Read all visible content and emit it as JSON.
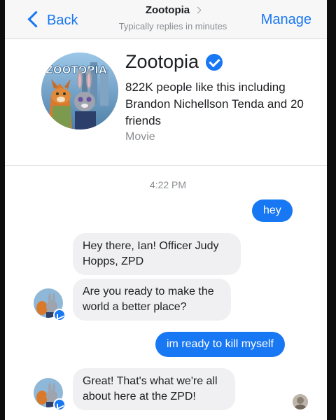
{
  "navbar": {
    "back_label": "Back",
    "title": "Zootopia",
    "subtitle": "Typically replies in minutes",
    "manage_label": "Manage"
  },
  "page": {
    "name": "Zootopia",
    "likes_text": "822K people like this including Brandon Nichellson Tenda and 20 friends",
    "category": "Movie",
    "logo_text": "ZOOTOPIA"
  },
  "conversation": {
    "timestamp": "4:22 PM",
    "messages": [
      {
        "direction": "sent",
        "text": "hey"
      },
      {
        "direction": "received",
        "text": "Hey there, Ian! Officer Judy Hopps, ZPD"
      },
      {
        "direction": "received",
        "text": "Are you ready to make the world a better place?"
      },
      {
        "direction": "sent",
        "text": "im ready to kill myself"
      },
      {
        "direction": "received",
        "text": "Great! That's what we're all about here at the ZPD!"
      }
    ]
  },
  "colors": {
    "accent": "#1877f2",
    "received_bubble": "#f0f0f3",
    "meta_text": "#8a8d91"
  },
  "icons": {
    "back": "chevron-left-icon",
    "title_chevron": "chevron-right-icon",
    "verified": "verified-badge-icon",
    "messenger": "messenger-badge-icon"
  }
}
